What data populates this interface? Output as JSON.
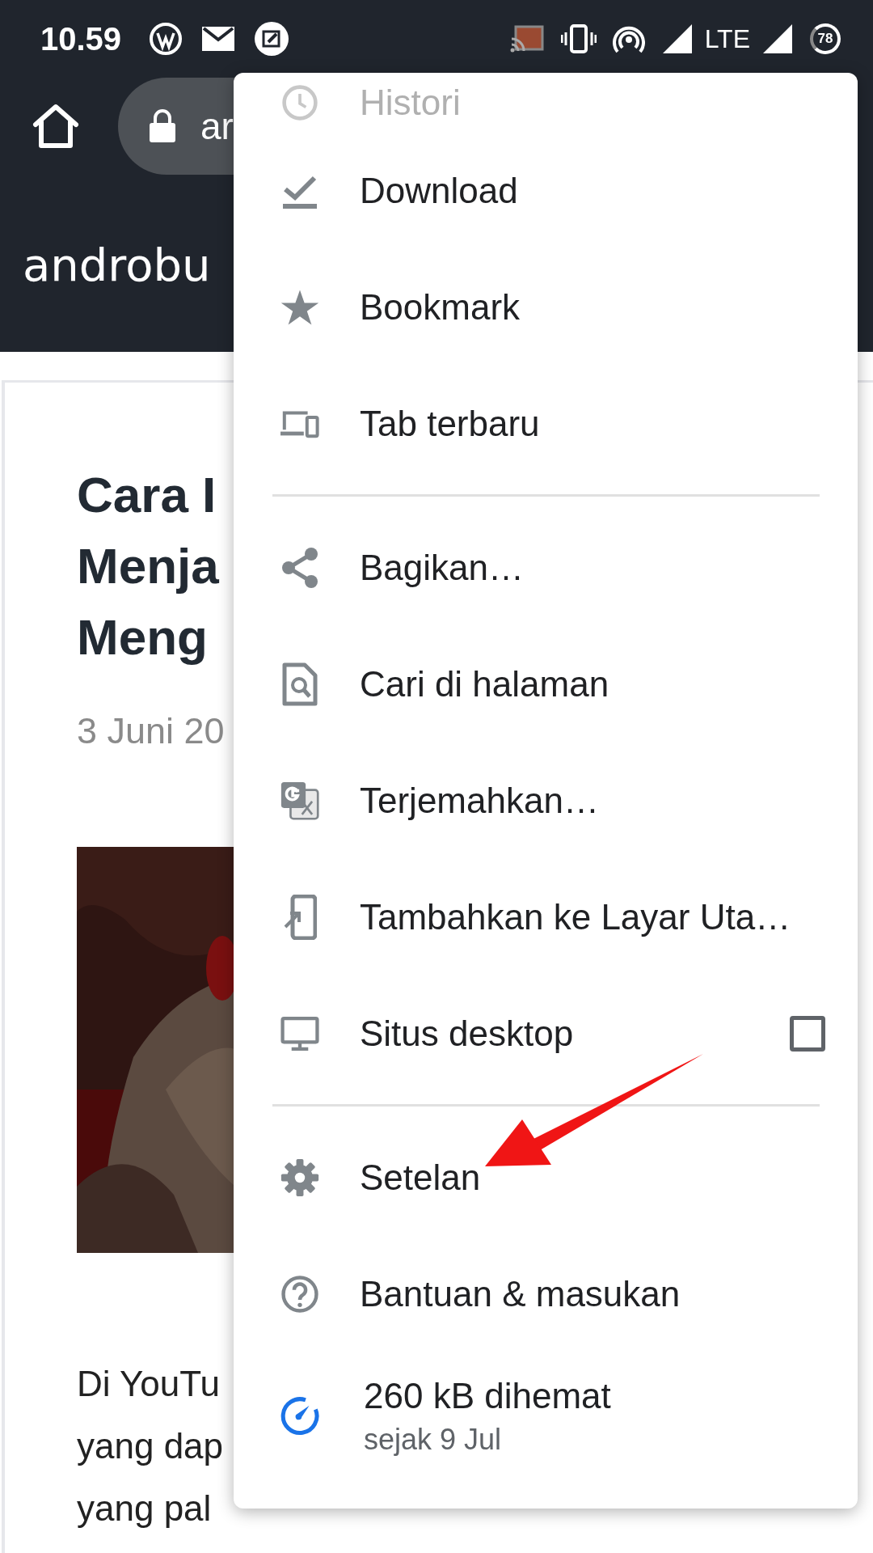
{
  "status_bar": {
    "time": "10.59",
    "network": "LTE",
    "battery": "78"
  },
  "toolbar": {
    "url": "ar"
  },
  "site": {
    "logo": "androbu"
  },
  "article": {
    "title_lines": [
      "Cara I",
      "Menja",
      "Meng"
    ],
    "date": "3 Juni 20",
    "body_lines": [
      "Di YouTu",
      "yang dap",
      "yang pal"
    ]
  },
  "menu": {
    "items": [
      {
        "kind": "item",
        "label": "Histori"
      },
      {
        "kind": "item",
        "label": "Download"
      },
      {
        "kind": "item",
        "label": "Bookmark"
      },
      {
        "kind": "item",
        "label": "Tab terbaru"
      },
      {
        "kind": "divider"
      },
      {
        "kind": "item",
        "label": "Bagikan…"
      },
      {
        "kind": "item",
        "label": "Cari di halaman"
      },
      {
        "kind": "item",
        "label": "Terjemahkan…"
      },
      {
        "kind": "item",
        "label": "Tambahkan ke Layar Uta…"
      },
      {
        "kind": "checkbox",
        "label": "Situs desktop",
        "checked": false
      },
      {
        "kind": "divider"
      },
      {
        "kind": "item",
        "label": "Setelan"
      },
      {
        "kind": "item",
        "label": "Bantuan & masukan"
      },
      {
        "kind": "savings",
        "label": "260 kB dihemat",
        "sublabel": "sejak 9 Jul"
      }
    ]
  }
}
